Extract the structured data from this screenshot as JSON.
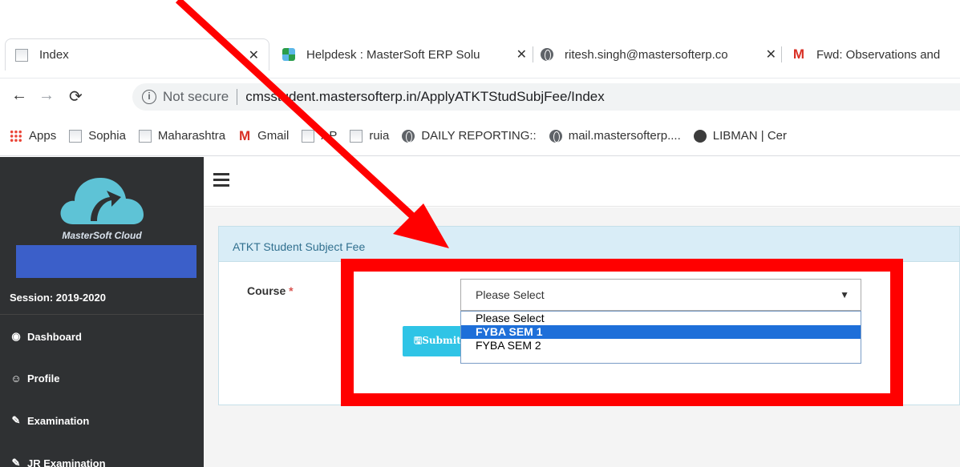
{
  "browser": {
    "tabs": [
      {
        "title": "Index",
        "favicon": "document-icon",
        "active": true
      },
      {
        "title": "Helpdesk : MasterSoft ERP Solu",
        "favicon": "helpdesk-icon"
      },
      {
        "title": "ritesh.singh@mastersofterp.co",
        "favicon": "globe-icon"
      },
      {
        "title": "Fwd: Observations and",
        "favicon": "gmail-icon"
      }
    ],
    "security_label": "Not secure",
    "url": "cmsstudent.mastersofterp.in/ApplyATKTStudSubjFee/Index",
    "bookmarks": [
      {
        "label": "Apps",
        "icon": "apps-grid-icon"
      },
      {
        "label": "Sophia",
        "icon": "document-icon"
      },
      {
        "label": "Maharashtra",
        "icon": "document-icon"
      },
      {
        "label": "Gmail",
        "icon": "gmail-icon"
      },
      {
        "label": "AP",
        "icon": "document-icon"
      },
      {
        "label": "ruia",
        "icon": "document-icon"
      },
      {
        "label": "DAILY REPORTING::",
        "icon": "globe-icon"
      },
      {
        "label": "mail.mastersofterp....",
        "icon": "globe-icon"
      },
      {
        "label": "LIBMAN | Cer",
        "icon": "libman-icon"
      }
    ]
  },
  "sidebar": {
    "brand": "MasterSoft Cloud",
    "session": "Session: 2019-2020",
    "items": [
      {
        "label": "Dashboard",
        "icon": "dashboard-icon"
      },
      {
        "label": "Profile",
        "icon": "user-icon"
      },
      {
        "label": "Examination",
        "icon": "pencil-icon"
      },
      {
        "label": "JR Examination",
        "icon": "pencil-icon"
      }
    ]
  },
  "panel": {
    "title": "ATKT Student Subject Fee",
    "course_label": "Course",
    "required_mark": "*",
    "submit_label": "Submit",
    "select": {
      "selected": "Please Select",
      "options": [
        "Please Select",
        "FYBA SEM 1",
        "FYBA SEM 2"
      ],
      "highlighted": "FYBA SEM 1"
    }
  },
  "colors": {
    "annotation": "#ff0000",
    "sidebar_bg": "#2f3133",
    "panel_header_bg": "#d9edf7",
    "submit_bg": "#2fc4e6",
    "option_highlight": "#1e6fd9"
  }
}
